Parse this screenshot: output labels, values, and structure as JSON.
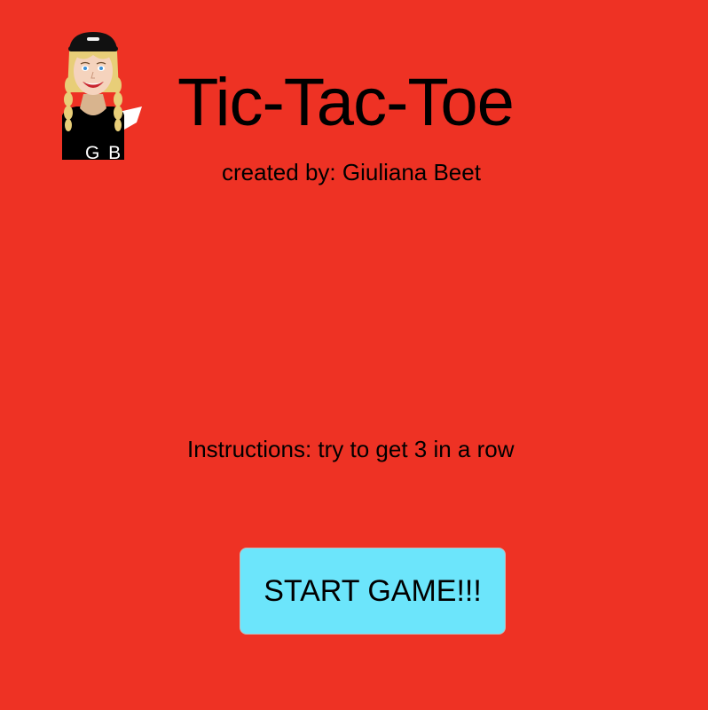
{
  "header": {
    "avatar_initials": "G B",
    "title": "Tic-Tac-Toe",
    "subtitle": "created by: Giuliana Beet"
  },
  "main": {
    "instructions": "Instructions: try to get 3 in a row",
    "start_button_label": "START GAME!!!"
  },
  "colors": {
    "background": "#ee3224",
    "button": "#6ce5fb",
    "text": "#000000"
  }
}
